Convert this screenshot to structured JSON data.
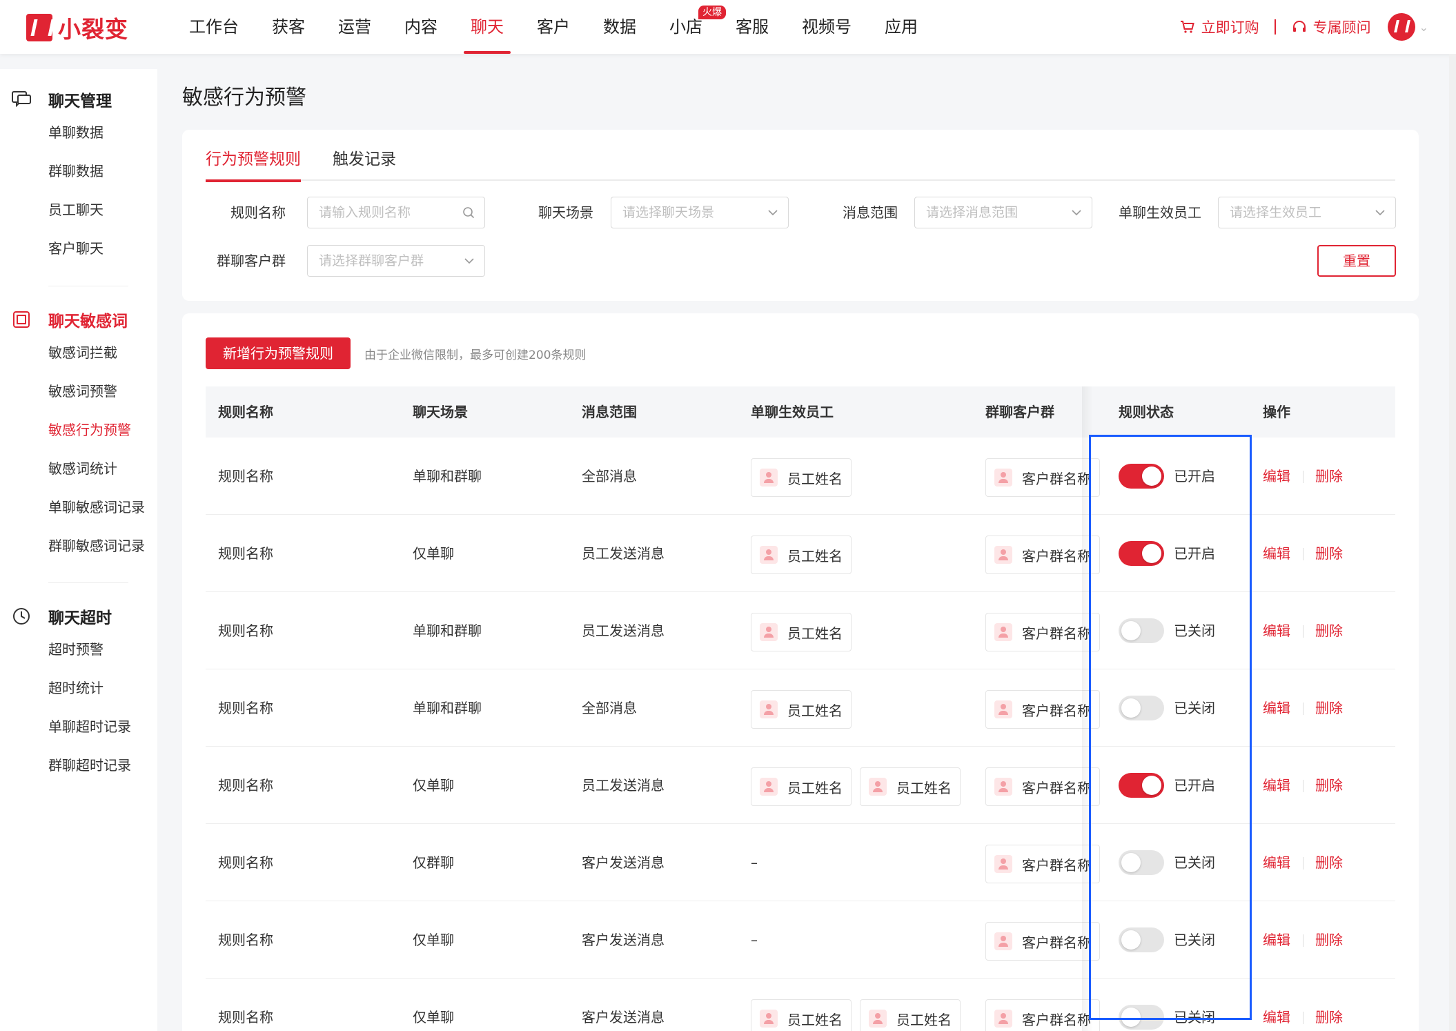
{
  "brand": {
    "name": "小裂变"
  },
  "nav": [
    {
      "label": "工作台",
      "active": false
    },
    {
      "label": "获客",
      "active": false
    },
    {
      "label": "运营",
      "active": false
    },
    {
      "label": "内容",
      "active": false
    },
    {
      "label": "聊天",
      "active": true
    },
    {
      "label": "客户",
      "active": false
    },
    {
      "label": "数据",
      "active": false
    },
    {
      "label": "小店",
      "active": false,
      "badge": "火爆"
    },
    {
      "label": "客服",
      "active": false
    },
    {
      "label": "视频号",
      "active": false
    },
    {
      "label": "应用",
      "active": false
    }
  ],
  "top_right": {
    "subscribe": "立即订购",
    "advisor": "专属顾问"
  },
  "sidebar": {
    "groups": [
      {
        "title": "聊天管理",
        "items": [
          "单聊数据",
          "群聊数据",
          "员工聊天",
          "客户聊天"
        ]
      },
      {
        "title": "聊天敏感词",
        "items": [
          "敏感词拦截",
          "敏感词预警",
          "敏感行为预警",
          "敏感词统计",
          "单聊敏感词记录",
          "群聊敏感词记录"
        ]
      },
      {
        "title": "聊天超时",
        "items": [
          "超时预警",
          "超时统计",
          "单聊超时记录",
          "群聊超时记录"
        ]
      }
    ],
    "active_item": "敏感行为预警"
  },
  "page": {
    "title": "敏感行为预警"
  },
  "tabs": [
    {
      "label": "行为预警规则",
      "active": true
    },
    {
      "label": "触发记录",
      "active": false
    }
  ],
  "filters": {
    "rule_name": {
      "label": "规则名称",
      "placeholder": "请输入规则名称"
    },
    "scene": {
      "label": "聊天场景",
      "placeholder": "请选择聊天场景"
    },
    "scope": {
      "label": "消息范围",
      "placeholder": "请选择消息范围"
    },
    "employee": {
      "label": "单聊生效员工",
      "placeholder": "请选择生效员工"
    },
    "group": {
      "label": "群聊客户群",
      "placeholder": "请选择群聊客户群"
    },
    "reset": "重置"
  },
  "toolbar": {
    "add_label": "新增行为预警规则",
    "hint": "由于企业微信限制，最多可创建200条规则"
  },
  "table": {
    "columns": [
      "规则名称",
      "聊天场景",
      "消息范围",
      "单聊生效员工",
      "群聊客户群",
      "规则状态",
      "操作"
    ],
    "actions": {
      "edit": "编辑",
      "delete": "删除"
    },
    "rows": [
      {
        "name": "规则名称",
        "scene": "单聊和群聊",
        "scope": "全部消息",
        "employees": [
          "员工姓名"
        ],
        "group": "客户群名称",
        "on": true,
        "status": "已开启"
      },
      {
        "name": "规则名称",
        "scene": "仅单聊",
        "scope": "员工发送消息",
        "employees": [
          "员工姓名"
        ],
        "group": "客户群名称",
        "on": true,
        "status": "已开启"
      },
      {
        "name": "规则名称",
        "scene": "单聊和群聊",
        "scope": "员工发送消息",
        "employees": [
          "员工姓名"
        ],
        "group": "客户群名称",
        "on": false,
        "status": "已关闭"
      },
      {
        "name": "规则名称",
        "scene": "单聊和群聊",
        "scope": "全部消息",
        "employees": [
          "员工姓名"
        ],
        "group": "客户群名称",
        "on": false,
        "status": "已关闭"
      },
      {
        "name": "规则名称",
        "scene": "仅单聊",
        "scope": "员工发送消息",
        "employees": [
          "员工姓名",
          "员工姓名"
        ],
        "group": "客户群名称",
        "on": true,
        "status": "已开启"
      },
      {
        "name": "规则名称",
        "scene": "仅群聊",
        "scope": "客户发送消息",
        "employees": [],
        "empty": "–",
        "group": "客户群名称",
        "on": false,
        "status": "已关闭"
      },
      {
        "name": "规则名称",
        "scene": "仅单聊",
        "scope": "客户发送消息",
        "employees": [],
        "empty": "–",
        "group": "客户群名称",
        "on": false,
        "status": "已关闭"
      },
      {
        "name": "规则名称",
        "scene": "仅单聊",
        "scope": "客户发送消息",
        "employees": [
          "员工姓名",
          "员工姓名"
        ],
        "group": "客户群名称",
        "on": false,
        "status": "已关闭"
      }
    ]
  },
  "colors": {
    "accent": "#e02433",
    "highlight": "#1a5cff"
  }
}
